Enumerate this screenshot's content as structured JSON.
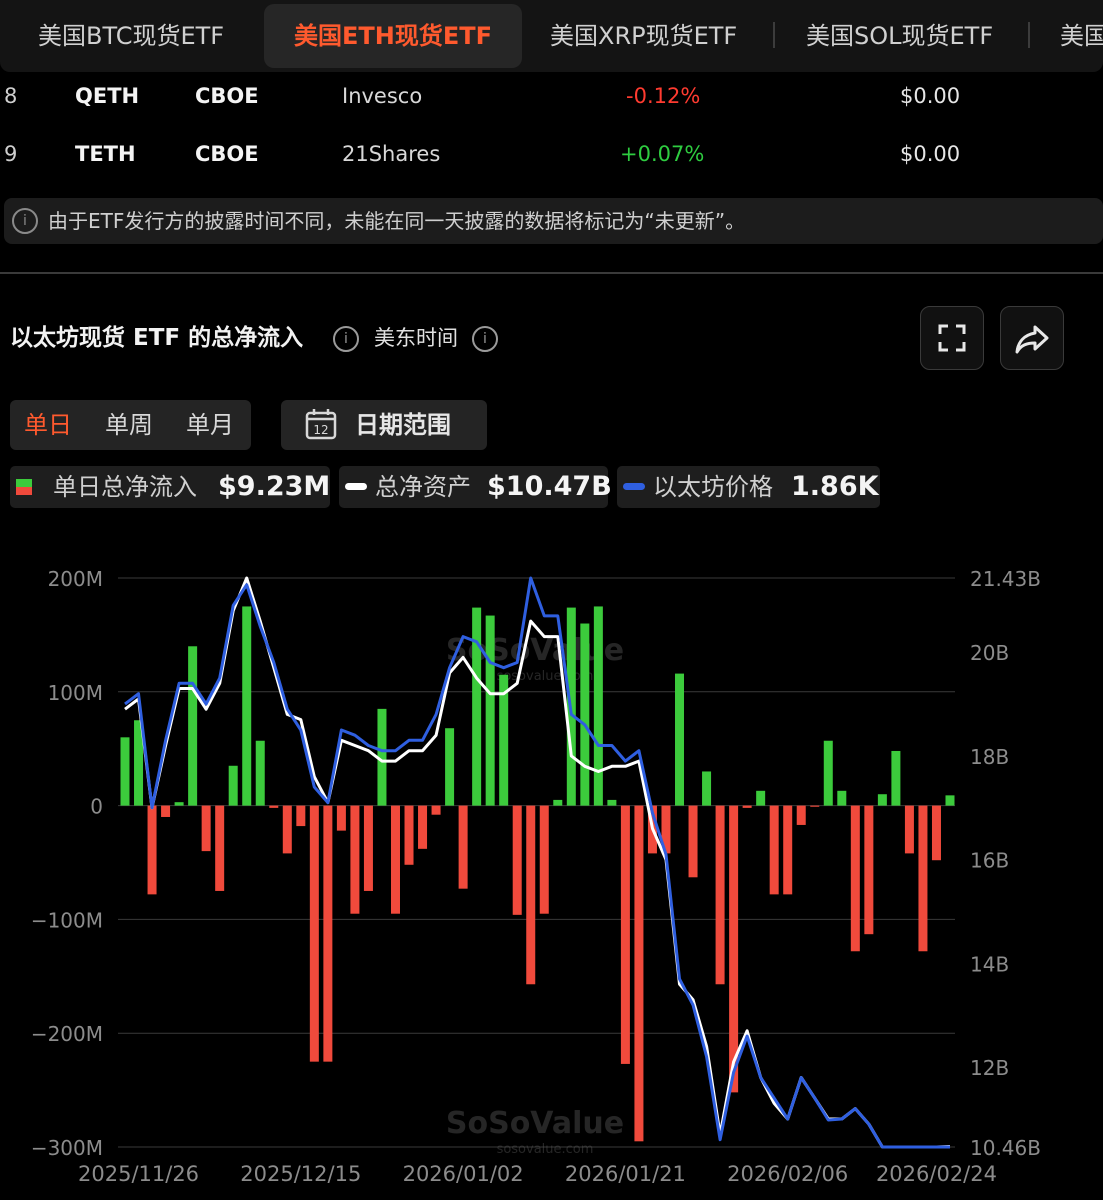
{
  "tabs": [
    {
      "label": "美国BTC现货ETF",
      "active": false
    },
    {
      "label": "美国ETH现货ETF",
      "active": true
    },
    {
      "label": "美国XRP现货ETF",
      "active": false
    },
    {
      "label": "美国SOL现货ETF",
      "active": false
    },
    {
      "label": "美国",
      "active": false
    }
  ],
  "table_rows": [
    {
      "rank": "8",
      "ticker": "QETH",
      "exchange": "CBOE",
      "issuer": "Invesco",
      "change": "-0.12%",
      "change_color": "#ff3b30",
      "value": "$0.00"
    },
    {
      "rank": "9",
      "ticker": "TETH",
      "exchange": "CBOE",
      "issuer": "21Shares",
      "change": "+0.07%",
      "change_color": "#2ecc40",
      "value": "$0.00"
    }
  ],
  "notice": {
    "icon": "info-icon",
    "text": "由于ETF发行方的披露时间不同，未能在同一天披露的数据将标记为“未更新”。"
  },
  "chart_header": {
    "title": "以太坊现货 ETF 的总净流入",
    "timezone": "美东时间",
    "fullscreen_icon": "fullscreen-icon",
    "share_icon": "share-icon"
  },
  "period_tabs": [
    {
      "label": "单日",
      "active": true
    },
    {
      "label": "单周",
      "active": false
    },
    {
      "label": "单月",
      "active": false
    }
  ],
  "date_range": {
    "label": "日期范围",
    "icon": "calendar-icon",
    "icon_text": "12"
  },
  "legend": [
    {
      "label": "单日总净流入",
      "value": "$9.23M"
    },
    {
      "label": "总净资产",
      "value": "$10.47B"
    },
    {
      "label": "以太坊价格",
      "value": "1.86K"
    }
  ],
  "colors": {
    "inflow": "#3ccb3c",
    "outflow": "#f04a3c",
    "assets_line": "#ffffff",
    "price_line": "#2f5fe0",
    "accent": "#ff5a2e"
  },
  "chart_data": {
    "type": "bar",
    "left_axis": {
      "ticks": [
        "200M",
        "100M",
        "0",
        "−100M",
        "−200M",
        "−300M"
      ],
      "range": [
        -300,
        200
      ],
      "unit": "M"
    },
    "right_axis": {
      "ticks": [
        "21.43B",
        "20B",
        "18B",
        "16B",
        "14B",
        "12B",
        "10.46B"
      ],
      "tick_values": [
        21.43,
        20,
        18,
        16,
        14,
        12,
        10.46
      ],
      "range": [
        10.46,
        21.43
      ],
      "unit": "B"
    },
    "x_ticks": [
      "2025/11/26",
      "2025/12/15",
      "2026/01/02",
      "2026/01/21",
      "2026/02/06",
      "2026/02/24"
    ],
    "x_tick_index": [
      1,
      13,
      25,
      37,
      49,
      60
    ],
    "grid": true,
    "watermark": "SoSoValue",
    "watermark_sub": "sosovalue.com",
    "series": [
      {
        "name": "单日总净流入",
        "kind": "bar",
        "values": [
          60,
          75,
          -78,
          -10,
          3,
          140,
          -40,
          -75,
          35,
          175,
          57,
          -2,
          -42,
          -18,
          -225,
          -225,
          -22,
          -95,
          -75,
          85,
          -95,
          -52,
          -38,
          -8,
          68,
          -73,
          174,
          167,
          115,
          -96,
          -157,
          -95,
          5,
          174,
          160,
          175,
          5,
          -227,
          -295,
          -42,
          -42,
          116,
          -63,
          30,
          -157,
          -252,
          -2,
          13,
          -78,
          -78,
          -17,
          -1,
          57,
          13,
          -128,
          -113,
          10,
          48,
          -42,
          -128,
          -48,
          9
        ],
        "pos_color": "#3ccb3c",
        "neg_color": "#f04a3c"
      },
      {
        "name": "总净资产",
        "kind": "line",
        "color": "#ffffff",
        "values": [
          18.9,
          19.1,
          17.0,
          18.2,
          19.3,
          19.3,
          18.9,
          19.4,
          20.8,
          21.43,
          20.6,
          19.7,
          18.8,
          18.7,
          17.6,
          17.1,
          18.3,
          18.2,
          18.1,
          17.9,
          17.9,
          18.1,
          18.1,
          18.4,
          19.6,
          19.9,
          19.5,
          19.2,
          19.2,
          19.4,
          20.6,
          20.3,
          20.3,
          18.0,
          17.8,
          17.7,
          17.8,
          17.8,
          17.9,
          16.6,
          16.0,
          13.6,
          13.3,
          12.4,
          10.7,
          12.1,
          12.7,
          11.8,
          11.3,
          11.0,
          11.8,
          11.4,
          11.0,
          11.0,
          11.2,
          10.9,
          10.46,
          10.46,
          10.46,
          10.46,
          10.46,
          10.47
        ]
      },
      {
        "name": "以太坊价格",
        "kind": "line",
        "color": "#2f5fe0",
        "values": [
          19.0,
          19.2,
          17.0,
          18.3,
          19.4,
          19.4,
          19.0,
          19.5,
          20.9,
          21.3,
          20.5,
          19.8,
          18.9,
          18.5,
          17.4,
          17.1,
          18.5,
          18.4,
          18.2,
          18.1,
          18.1,
          18.3,
          18.3,
          18.8,
          19.7,
          20.3,
          20.2,
          19.8,
          19.7,
          19.8,
          21.43,
          20.7,
          20.7,
          18.8,
          18.6,
          18.2,
          18.2,
          17.9,
          18.1,
          16.9,
          16.1,
          13.7,
          13.2,
          12.2,
          10.6,
          11.9,
          12.6,
          11.8,
          11.4,
          11.0,
          11.8,
          11.4,
          10.98,
          11.0,
          11.2,
          10.9,
          10.46,
          10.46,
          10.46,
          10.46,
          10.46,
          10.46
        ]
      }
    ]
  }
}
